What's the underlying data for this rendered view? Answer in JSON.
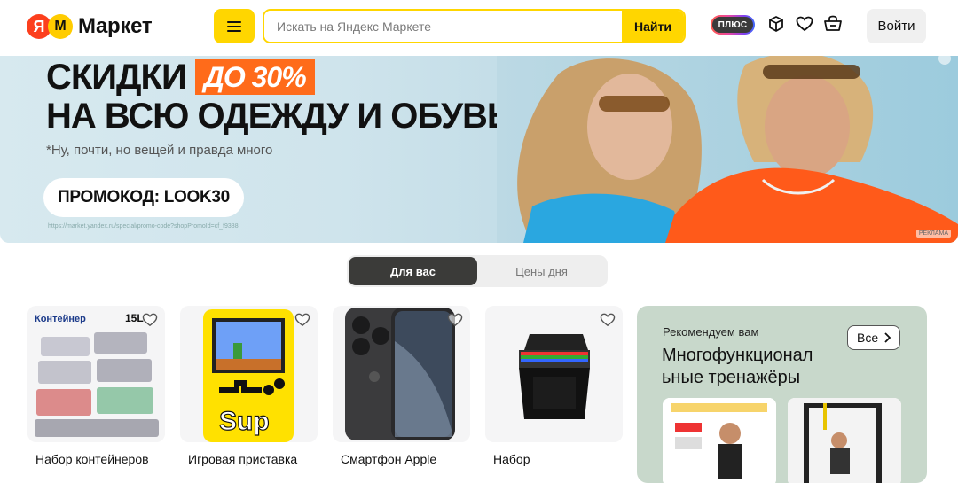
{
  "header": {
    "logo_ya": "Я",
    "logo_m": "M",
    "logo_text": "Маркет",
    "search_placeholder": "Искать на Яндекс Маркете",
    "search_button": "Найти",
    "plus_label": "ПЛЮС",
    "login_label": "Войти",
    "icons": [
      "menu-icon",
      "orders-box-icon",
      "favorites-heart-icon",
      "cart-icon"
    ]
  },
  "banner": {
    "headline_1": "СКИДКИ",
    "discount_tag": "ДО 30%",
    "headline_2": "НА ВСЮ ОДЕЖДУ И ОБУВЬ",
    "subline": "*Ну, почти, но вещей и правда много",
    "promo_code": "ПРОМОКОД: LOOK30",
    "promo_url": "https://market.yandex.ru/special/promo-code?shopPromoId=cf_f9388",
    "ad_label": "РЕКЛАМА",
    "accent_color": "#ff6b1a"
  },
  "tabs": [
    {
      "label": "Для вас",
      "active": true
    },
    {
      "label": "Цены дня",
      "active": false
    }
  ],
  "products": [
    {
      "title": "Набор контейнеров",
      "image": "food-containers-image",
      "badge": "15L",
      "brand_text": "Контейнер"
    },
    {
      "title": "Игровая приставка",
      "image": "handheld-console-image"
    },
    {
      "title": "Смартфон Apple",
      "image": "iphone-image"
    },
    {
      "title": "Набор",
      "image": "markers-set-image"
    }
  ],
  "recommend": {
    "kicker": "Рекомендуем вам",
    "title": "Многофункционал ьные тренажёры",
    "all_label": "Все",
    "bg_color": "#c8d8cb"
  }
}
